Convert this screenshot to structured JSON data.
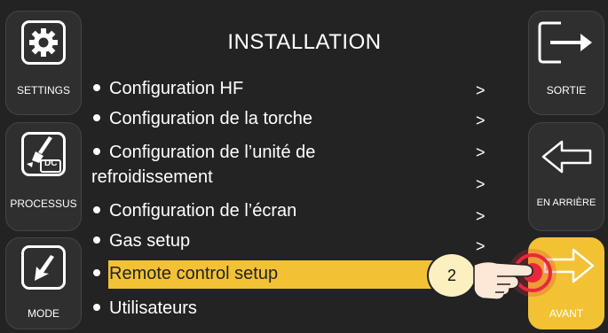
{
  "left_buttons": [
    {
      "label": "SETTINGS",
      "icon": "gear-icon"
    },
    {
      "label": "PROCESSUS",
      "icon": "welding-torch-dc-icon",
      "badge": "DC"
    },
    {
      "label": "MODE",
      "icon": "arrow-down-left-icon"
    }
  ],
  "right_buttons": [
    {
      "label": "SORTIE",
      "icon": "exit-arrow-icon"
    },
    {
      "label": "EN ARRIÈRE",
      "icon": "back-arrow-icon"
    },
    {
      "label": "AVANT",
      "icon": "forward-arrow-icon",
      "active": true
    }
  ],
  "main": {
    "title": "INSTALLATION",
    "items": [
      {
        "label": "Configuration HF"
      },
      {
        "label": "Configuration de la torche"
      },
      {
        "label": "Configuration de l’unité de"
      },
      {
        "label": "refroidissement"
      },
      {
        "label": "Configuration de l’écran"
      },
      {
        "label": "Gas setup"
      },
      {
        "label": "Remote control setup",
        "selected": true
      },
      {
        "label": "Utilisateurs"
      }
    ],
    "chevrons": [
      ">",
      ">",
      ">",
      ">",
      ">",
      ">"
    ]
  },
  "callout": {
    "number": "2",
    "icon": "pointing-hand-icon"
  },
  "colors": {
    "accent": "#f2c234",
    "background": "#232323",
    "button": "#2f2f2f",
    "touch_red": "#e8283a"
  }
}
